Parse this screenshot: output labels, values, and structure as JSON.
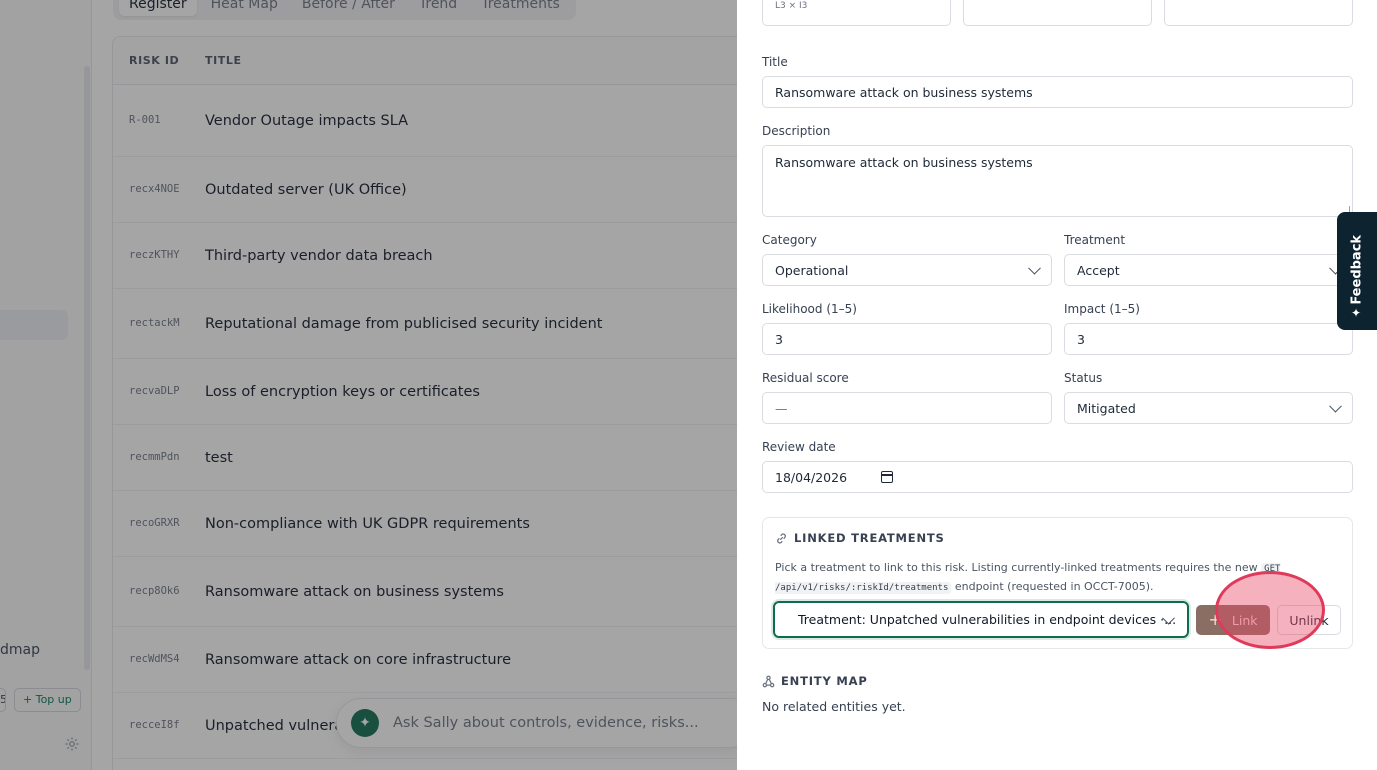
{
  "background": {
    "nav": {
      "roadmap_label": "dmap",
      "credit_label": "5",
      "topup_label": "+ Top up",
      "settings_icon": "gear-icon"
    },
    "tabs": [
      {
        "label": "Register",
        "active": true
      },
      {
        "label": "Heat Map",
        "active": false
      },
      {
        "label": "Before / After",
        "active": false
      },
      {
        "label": "Trend",
        "active": false
      },
      {
        "label": "Treatments",
        "active": false
      }
    ],
    "table": {
      "columns": [
        "RISK ID",
        "TITLE"
      ],
      "rows": [
        {
          "id": "R-001",
          "title": "Vendor Outage impacts SLA"
        },
        {
          "id": "recx4NOE",
          "title": "Outdated server (UK Office)"
        },
        {
          "id": "reczKTHY",
          "title": "Third-party vendor data breach"
        },
        {
          "id": "rectackM",
          "title": "Reputational damage from publicised security incident"
        },
        {
          "id": "recvaDLP",
          "title": "Loss of encryption keys or certificates"
        },
        {
          "id": "recmmPdn",
          "title": "test"
        },
        {
          "id": "recoGRXR",
          "title": "Non-compliance with UK GDPR requirements"
        },
        {
          "id": "recp8Ok6",
          "title": "Ransomware attack on business systems"
        },
        {
          "id": "recWdMS4",
          "title": "Ransomware attack on core infrastructure"
        },
        {
          "id": "recceI8f",
          "title": "Unpatched vulnera"
        }
      ]
    },
    "assistant": {
      "placeholder": "Ask Sally about controls, evidence, risks..."
    }
  },
  "drawer": {
    "score_hint": "L3 × I3",
    "title": {
      "label": "Title",
      "value": "Ransomware attack on business systems"
    },
    "description": {
      "label": "Description",
      "value": "Ransomware attack on business systems"
    },
    "category": {
      "label": "Category",
      "value": "Operational"
    },
    "treatment": {
      "label": "Treatment",
      "value": "Accept"
    },
    "likelihood": {
      "label": "Likelihood (1–5)",
      "value": "3"
    },
    "impact": {
      "label": "Impact (1–5)",
      "value": "3"
    },
    "residual": {
      "label": "Residual score",
      "value": "—"
    },
    "status": {
      "label": "Status",
      "value": "Mitigated"
    },
    "review_date": {
      "label": "Review date",
      "value": "18/04/2026"
    },
    "linked_treatments": {
      "heading": "LINKED TREATMENTS",
      "desc_before": "Pick a treatment to link to this risk. Listing currently-linked treatments requires the new",
      "desc_code": "GET /api/v1/risks/:riskId/treatments",
      "desc_after": "endpoint (requested in OCCT-7005).",
      "selected": "Treatment: Unpatched vulnerabilities in endpoint devices  ·...",
      "link_label": "Link",
      "unlink_label": "Unlink"
    },
    "entity_map": {
      "heading": "ENTITY MAP",
      "empty": "No related entities yet."
    }
  },
  "feedback": {
    "label": "Feedback"
  }
}
